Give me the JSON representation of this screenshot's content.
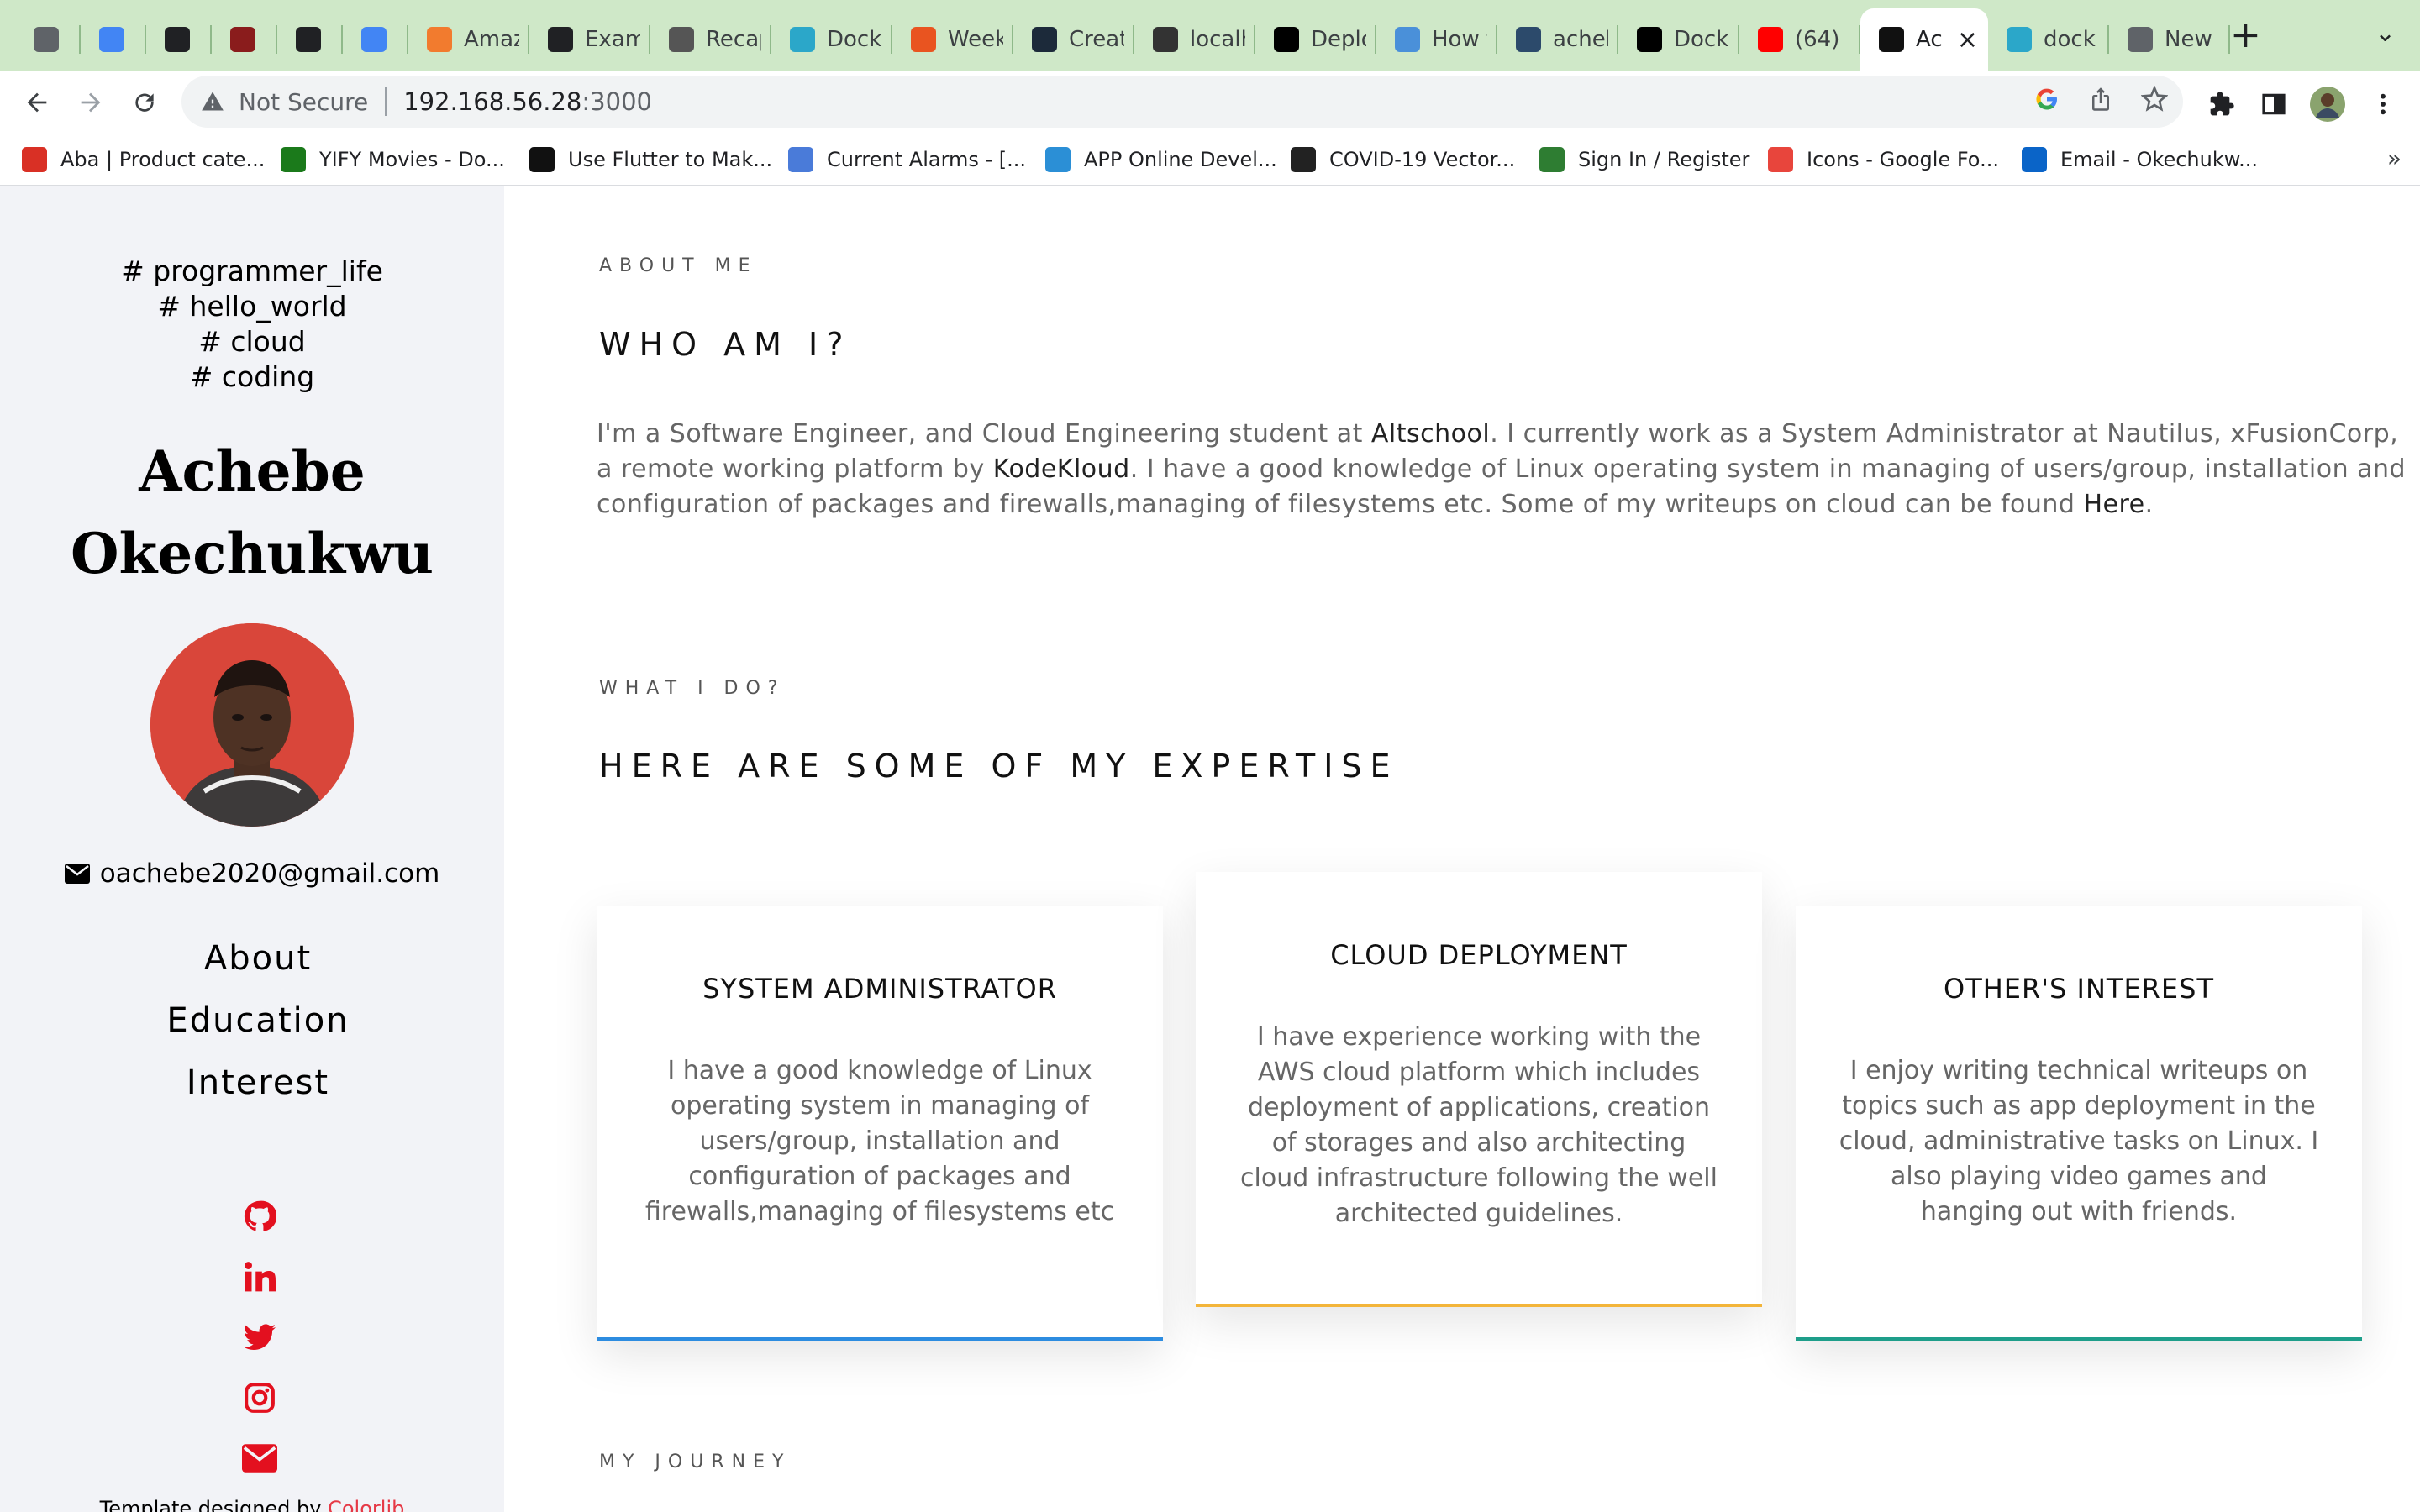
{
  "tabs": [
    {
      "title": "",
      "favicon_color": "#5f6368",
      "icon": "browser-icon"
    },
    {
      "title": "",
      "favicon_color": "#4285f4",
      "icon": "docs-icon"
    },
    {
      "title": "",
      "favicon_color": "#202124",
      "icon": "globe-icon"
    },
    {
      "title": "",
      "favicon_color": "#8a1c1c",
      "icon": "hi-icon"
    },
    {
      "title": "",
      "favicon_color": "#202124",
      "icon": "globe-icon"
    },
    {
      "title": "",
      "favicon_color": "#4285f4",
      "icon": "docs-icon"
    },
    {
      "title": "Amaz",
      "favicon_color": "#f27b2e",
      "icon": "aws-icon"
    },
    {
      "title": "Exam",
      "favicon_color": "#202124",
      "icon": "github-icon"
    },
    {
      "title": "Recap",
      "favicon_color": "#555555",
      "icon": "slides-icon"
    },
    {
      "title": "Dock",
      "favicon_color": "#2ba7c9",
      "icon": "docker-icon"
    },
    {
      "title": "Week",
      "favicon_color": "#e95420",
      "icon": "ubuntu-icon"
    },
    {
      "title": "Creat",
      "favicon_color": "#1c2a3a",
      "icon": "react-icon"
    },
    {
      "title": "localh",
      "favicon_color": "#333333",
      "icon": "local-icon"
    },
    {
      "title": "Deplo",
      "favicon_color": "#000000",
      "icon": "medium-icon"
    },
    {
      "title": "How t",
      "favicon_color": "#4a90d9",
      "icon": "infinity-icon"
    },
    {
      "title": "acheb",
      "favicon_color": "#2c4a6b",
      "icon": "hashnode-icon"
    },
    {
      "title": "Dock",
      "favicon_color": "#000000",
      "icon": "circle-icon"
    },
    {
      "title": "(64)",
      "favicon_color": "#ff0000",
      "icon": "youtube-icon"
    },
    {
      "title": "Ac",
      "favicon_color": "#111111",
      "icon": "site-icon",
      "active": true
    },
    {
      "title": "dock",
      "favicon_color": "#2ba7c9",
      "icon": "docker-icon"
    },
    {
      "title": "New",
      "favicon_color": "#5f6368",
      "icon": "chrome-icon"
    }
  ],
  "address_bar": {
    "security_label": "Not Secure",
    "host": "192.168.56.28",
    "port": ":3000"
  },
  "bookmarks": [
    {
      "label": "Aba | Product cate...",
      "color": "#d93025",
      "icon": "aba-icon"
    },
    {
      "label": "YIFY Movies - Do...",
      "color": "#1b7a1b",
      "icon": "yify-icon"
    },
    {
      "label": "Use Flutter to Mak...",
      "color": "#111111",
      "icon": "flutter-icon"
    },
    {
      "label": "Current Alarms - [...",
      "color": "#4a7bd9",
      "icon": "alarm-icon"
    },
    {
      "label": "APP Online Devel...",
      "color": "#2b8fd6",
      "icon": "cloud-icon"
    },
    {
      "label": "COVID-19 Vector...",
      "color": "#222222",
      "icon": "covid-icon"
    },
    {
      "label": "Sign In / Register",
      "color": "#2e7d32",
      "icon": "signin-icon"
    },
    {
      "label": "Icons - Google Fo...",
      "color": "#e8453c",
      "icon": "google-fonts-icon"
    },
    {
      "label": "Email - Okechukw...",
      "color": "#0a64c8",
      "icon": "outlook-icon"
    }
  ],
  "sidebar": {
    "hashtags": [
      "# programmer_life",
      "# hello_world",
      "# cloud",
      "# coding"
    ],
    "name_line1": "Achebe",
    "name_line2": "Okechukwu",
    "email": "oachebe2020@gmail.com",
    "nav": [
      "About",
      "Education",
      "Interest"
    ],
    "socials": [
      "github-icon",
      "linkedin-icon",
      "twitter-icon",
      "instagram-icon",
      "mail-icon"
    ],
    "social_color": "#e3101f",
    "template_prefix": "Template designed by",
    "template_link": "Colorlib"
  },
  "about": {
    "eyebrow": "ABOUT ME",
    "heading": "WHO AM I?",
    "p_part1": "I'm a Software Engineer, and Cloud Engineering student at ",
    "p_altschool": "Altschool",
    "p_part2": ". I currently work as a System Administrator at Nautilus, xFusionCorp, a remote working platform by ",
    "p_kodekloud": "KodeKloud",
    "p_part3": ". I have a good knowledge of Linux operating system in managing of users/group, installation and configuration of packages and firewalls,managing of filesystems etc. Some of my writeups on cloud can be found ",
    "p_here": "Here",
    "p_end": "."
  },
  "expertise": {
    "eyebrow": "WHAT I DO?",
    "heading": "HERE ARE SOME OF MY EXPERTISE",
    "cards": [
      {
        "title": "SYSTEM ADMINISTRATOR",
        "body": "I have a good knowledge of Linux operating system in managing of users/group, installation and configuration of packages and firewalls,managing of filesystems etc",
        "accent": "#2d8ce0"
      },
      {
        "title": "CLOUD DEPLOYMENT",
        "body": "I have experience working with the AWS cloud platform which includes deployment of applications, creation of storages and also architecting cloud infrastructure following the well architected guidelines.",
        "accent": "#f3b53a"
      },
      {
        "title": "OTHER'S INTEREST",
        "body": "I enjoy writing technical writeups on topics such as app deployment in the cloud, administrative tasks on Linux. I also playing video games and hanging out with friends.",
        "accent": "#1e9e8a"
      }
    ]
  },
  "journey": {
    "eyebrow": "MY JOURNEY"
  }
}
